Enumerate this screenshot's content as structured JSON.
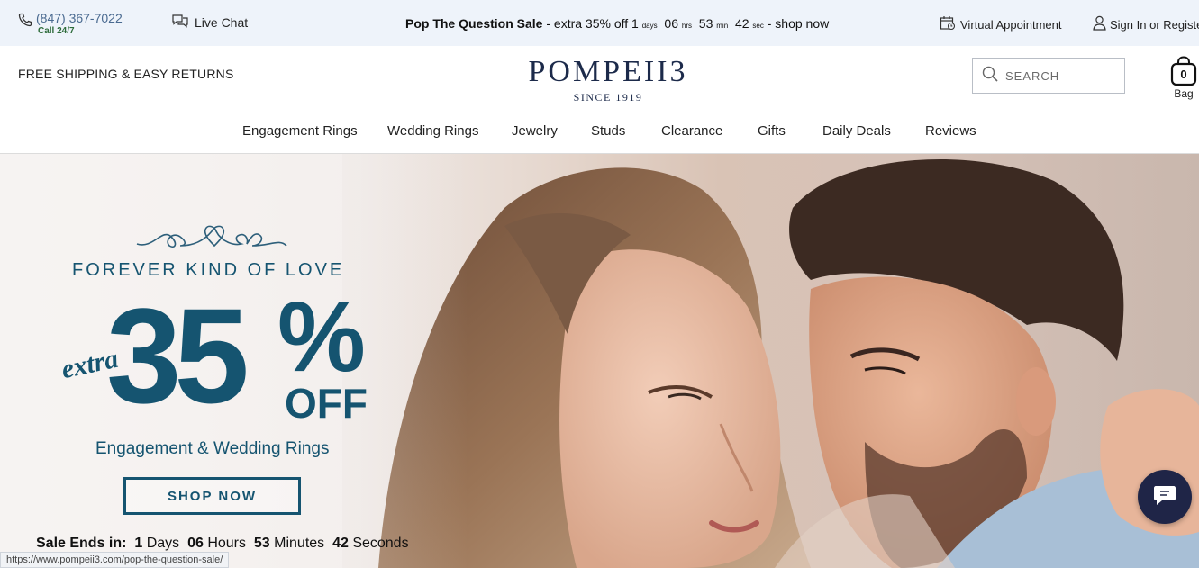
{
  "topbar": {
    "phone": "(847) 367-7022",
    "call_hours": "Call 24/7",
    "live_chat": "Live Chat",
    "sale_title": "Pop The Question Sale",
    "sale_text": " - extra 35% off ",
    "days_num": "1",
    "days_unit": "days",
    "hrs_num": "06",
    "hrs_unit": "hrs",
    "min_num": "53",
    "min_unit": "min",
    "sec_num": "42",
    "sec_unit": "sec",
    "shop_now": " - shop now",
    "virtual_appointment": "Virtual Appointment",
    "sign_in": "Sign In or Register"
  },
  "header": {
    "free_shipping": "FREE SHIPPING & EASY RETURNS",
    "logo_word": "POMPEII3",
    "logo_since": "SINCE 1919",
    "search_placeholder": "SEARCH",
    "bag_count": "0",
    "bag_label": "Bag"
  },
  "nav": {
    "items": [
      "Engagement Rings",
      "Wedding Rings",
      "Jewelry",
      "Studs",
      "Clearance",
      "Gifts",
      "Daily Deals",
      "Reviews"
    ]
  },
  "hero": {
    "tagline": "FOREVER KIND OF LOVE",
    "extra": "extra",
    "big": "35",
    "percent": "%",
    "off": "OFF",
    "subtitle": "Engagement & Wedding Rings",
    "cta": "SHOP NOW",
    "ends_label": "Sale Ends in:",
    "ends_days_num": "1",
    "ends_days": "Days",
    "ends_hours_num": "06",
    "ends_hours": "Hours",
    "ends_minutes_num": "53",
    "ends_minutes": "Minutes",
    "ends_seconds_num": "42",
    "ends_seconds": "Seconds"
  },
  "status_bar": {
    "url": "https://www.pompeii3.com/pop-the-question-sale/"
  },
  "colors": {
    "brand_navy": "#1c2a4a",
    "hero_blue": "#155470",
    "topbar_bg": "#eef3fa",
    "chat_bubble": "#1f2547"
  },
  "icons": [
    "phone-icon",
    "chat-icon",
    "calendar-icon",
    "user-icon",
    "search-icon",
    "bag-icon",
    "hearts-icon",
    "chat-bubble-icon"
  ]
}
